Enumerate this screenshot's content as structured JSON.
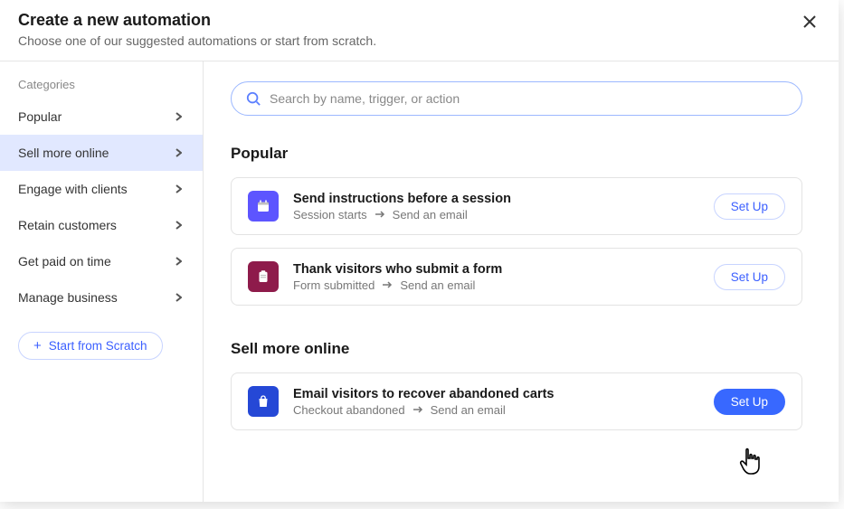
{
  "header": {
    "title": "Create a new automation",
    "subtitle": "Choose one of our suggested automations or start from scratch."
  },
  "sidebar": {
    "heading": "Categories",
    "items": [
      {
        "label": "Popular",
        "active": false
      },
      {
        "label": "Sell more online",
        "active": true
      },
      {
        "label": "Engage with clients",
        "active": false
      },
      {
        "label": "Retain customers",
        "active": false
      },
      {
        "label": "Get paid on time",
        "active": false
      },
      {
        "label": "Manage business",
        "active": false
      }
    ],
    "scratch_label": "Start from Scratch"
  },
  "search": {
    "placeholder": "Search by name, trigger, or action"
  },
  "sections": {
    "popular": {
      "title": "Popular",
      "cards": [
        {
          "icon_name": "calendar-icon",
          "icon_bg": "#5d55ff",
          "title": "Send instructions before a session",
          "trigger": "Session starts",
          "action": "Send an email",
          "setup_label": "Set Up",
          "primary": false
        },
        {
          "icon_name": "clipboard-icon",
          "icon_bg": "#8e1b4b",
          "title": "Thank visitors who submit a form",
          "trigger": "Form submitted",
          "action": "Send an email",
          "setup_label": "Set Up",
          "primary": false
        }
      ]
    },
    "sell_more": {
      "title": "Sell more online",
      "cards": [
        {
          "icon_name": "shopping-bag-icon",
          "icon_bg": "#2548d6",
          "title": "Email visitors to recover abandoned carts",
          "trigger": "Checkout abandoned",
          "action": "Send an email",
          "setup_label": "Set Up",
          "primary": true
        }
      ]
    }
  }
}
